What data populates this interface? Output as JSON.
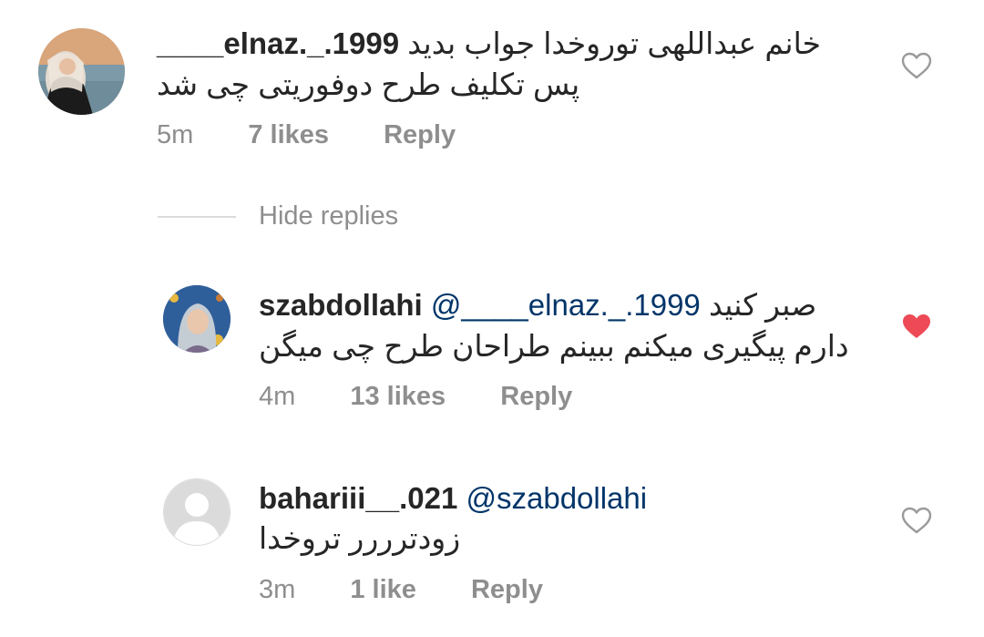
{
  "comments": [
    {
      "username": "____elnaz._.1999",
      "text_line1": "خانم عبداللهی توروخدا جواب بدید",
      "text_line2": "پس تکلیف  طرح دوفوریتی چی شد",
      "time": "5m",
      "likes": "7 likes",
      "reply": "Reply",
      "liked": false,
      "avatar_icon": "profile-photo-woman-hijab-by-sea"
    },
    {
      "username": "szabdollahi",
      "mention": "@____elnaz._.1999",
      "text_line1": "صبر کنید",
      "text_line2": "دارم پیگیری میکنم ببینم طراحان طرح چی میگن",
      "time": "4m",
      "likes": "13 likes",
      "reply": "Reply",
      "liked": true,
      "avatar_icon": "profile-photo-woman-hijab"
    },
    {
      "username": "bahariii__.021",
      "mention": "@szabdollahi",
      "text_line2": "زودترررر تروخدا",
      "time": "3m",
      "likes": "1 like",
      "reply": "Reply",
      "liked": false,
      "avatar_icon": "default-avatar-icon"
    }
  ],
  "hide_replies_label": "Hide replies",
  "colors": {
    "text": "#262626",
    "secondary": "#8e8e8e",
    "mention": "#003569",
    "heart_liked": "#ed4956",
    "heart_outline": "#9a9a9a"
  }
}
